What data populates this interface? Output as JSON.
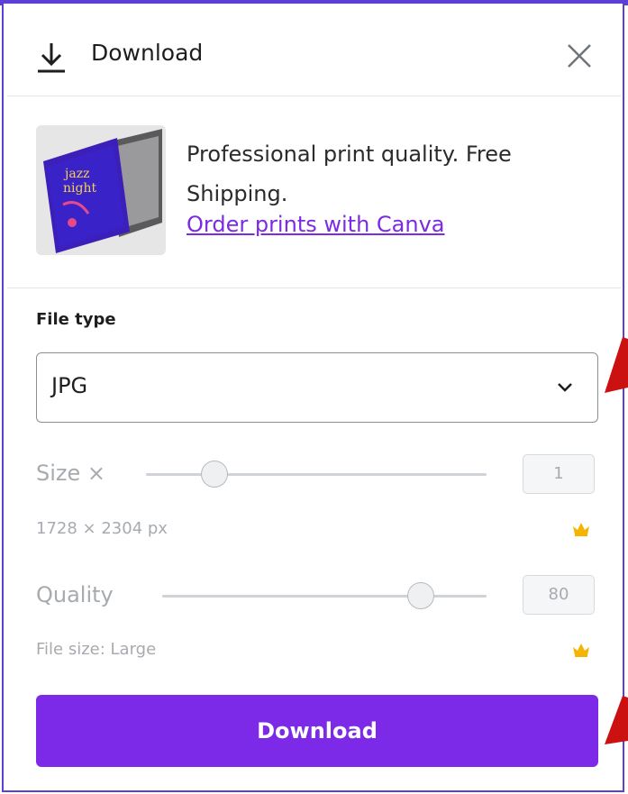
{
  "header": {
    "title": "Download"
  },
  "promo": {
    "text": "Professional print quality. Free Shipping.",
    "link": "Order prints with Canva",
    "thumb_lines": [
      "jazz",
      "night"
    ]
  },
  "file_type": {
    "label": "File type",
    "selected": "JPG"
  },
  "size": {
    "label": "Size ×",
    "value": "1",
    "dimensions": "1728 × 2304 px"
  },
  "quality": {
    "label": "Quality",
    "value": "80",
    "file_size": "File size: Large"
  },
  "actions": {
    "download_label": "Download"
  },
  "colors": {
    "accent": "#7d2ae8",
    "frame": "#5b3fd6",
    "crown": "#f5b400",
    "arrow": "#cc1111"
  },
  "icons": {
    "header": "download-icon",
    "close": "close-icon",
    "select": "chevron-down-icon",
    "pro": "crown-icon"
  }
}
